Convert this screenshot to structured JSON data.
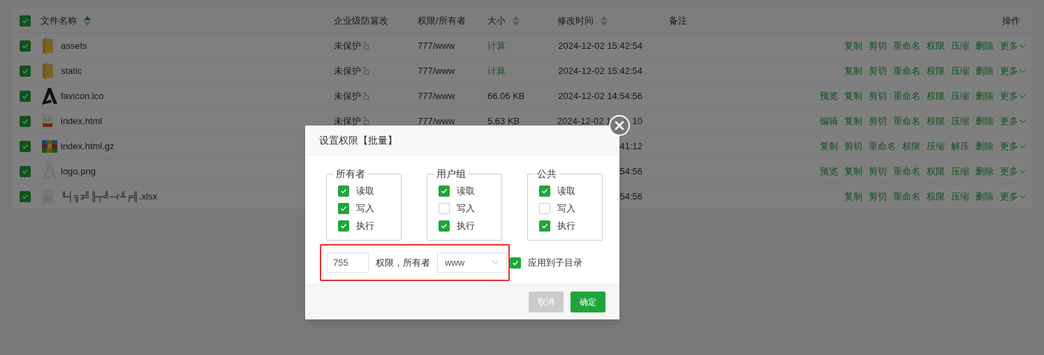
{
  "table": {
    "select_all": {
      "checked": true
    },
    "columns": [
      {
        "label": "文件名称",
        "sortable": true,
        "sorted": true
      },
      {
        "label": "企业级防篡改"
      },
      {
        "label": "权限/所有者"
      },
      {
        "label": "大小",
        "sortable": true,
        "sorted": false
      },
      {
        "label": "修改时间",
        "sortable": true,
        "sorted": false
      },
      {
        "label": "备注"
      },
      {
        "label": "操作"
      }
    ],
    "rows": [
      {
        "checked": true,
        "kind": "folder",
        "name": "assets",
        "protection": "未保护",
        "permission": "777/www",
        "size": "计算",
        "size_link": true,
        "modified": "2024-12-02 15:42:54",
        "actions": [
          "复制",
          "剪切",
          "重命名",
          "权限",
          "压缩",
          "删除"
        ],
        "more": "更多"
      },
      {
        "checked": true,
        "kind": "folder",
        "name": "static",
        "protection": "未保护",
        "permission": "777/www",
        "size": "计算",
        "size_link": true,
        "modified": "2024-12-02 15:42:54",
        "actions": [
          "复制",
          "剪切",
          "重命名",
          "权限",
          "压缩",
          "删除"
        ],
        "more": "更多"
      },
      {
        "checked": true,
        "kind": "icon",
        "name": "favicon.ico",
        "protection": "未保护",
        "permission": "777/www",
        "size": "66.06 KB",
        "size_link": false,
        "modified": "2024-12-02 14:54:56",
        "actions": [
          "预览",
          "复制",
          "剪切",
          "重命名",
          "权限",
          "压缩",
          "删除"
        ],
        "more": "更多"
      },
      {
        "checked": true,
        "kind": "html",
        "name": "index.html",
        "protection": "未保护",
        "permission": "777/www",
        "size": "5.63 KB",
        "size_link": false,
        "modified": "2024-12-02 1",
        "modified_tail": "10",
        "actions": [
          "编辑",
          "复制",
          "剪切",
          "重命名",
          "权限",
          "压缩",
          "删除"
        ],
        "more": "更多"
      },
      {
        "checked": true,
        "kind": "archive",
        "name": "index.html.gz",
        "modified": "41:12",
        "actions": [
          "复制",
          "剪切",
          "重命名",
          "权限",
          "压缩",
          "解压",
          "删除"
        ],
        "more": "更多"
      },
      {
        "checked": true,
        "kind": "image",
        "name": "logo.png",
        "modified": "54:56",
        "actions": [
          "预览",
          "复制",
          "剪切",
          "重命名",
          "权限",
          "压缩",
          "删除"
        ],
        "more": "更多"
      },
      {
        "checked": true,
        "kind": "spreadsheet",
        "name": "╙┤╗з╝╟┬╝─г╨╒╣.xlsx",
        "modified": "54:56",
        "actions": [
          "复制",
          "剪切",
          "重命名",
          "权限",
          "压缩",
          "删除"
        ],
        "more": "更多"
      }
    ]
  },
  "dialog": {
    "title": "设置权限【批量】",
    "groups": [
      {
        "label": "所有者",
        "permissions": [
          {
            "label": "读取",
            "checked": true
          },
          {
            "label": "写入",
            "checked": true
          },
          {
            "label": "执行",
            "checked": true
          }
        ]
      },
      {
        "label": "用户组",
        "permissions": [
          {
            "label": "读取",
            "checked": true
          },
          {
            "label": "写入",
            "checked": false
          },
          {
            "label": "执行",
            "checked": true
          }
        ]
      },
      {
        "label": "公共",
        "permissions": [
          {
            "label": "读取",
            "checked": true
          },
          {
            "label": "写入",
            "checked": false
          },
          {
            "label": "执行",
            "checked": true
          }
        ]
      }
    ],
    "mode_value": "755",
    "owner_label": "权限，所有者",
    "owner_value": "www",
    "apply_subdirs": {
      "label": "应用到子目录",
      "checked": true
    },
    "buttons": [
      {
        "label": "取消",
        "kind": "secondary"
      },
      {
        "label": "确定",
        "kind": "primary"
      }
    ]
  }
}
